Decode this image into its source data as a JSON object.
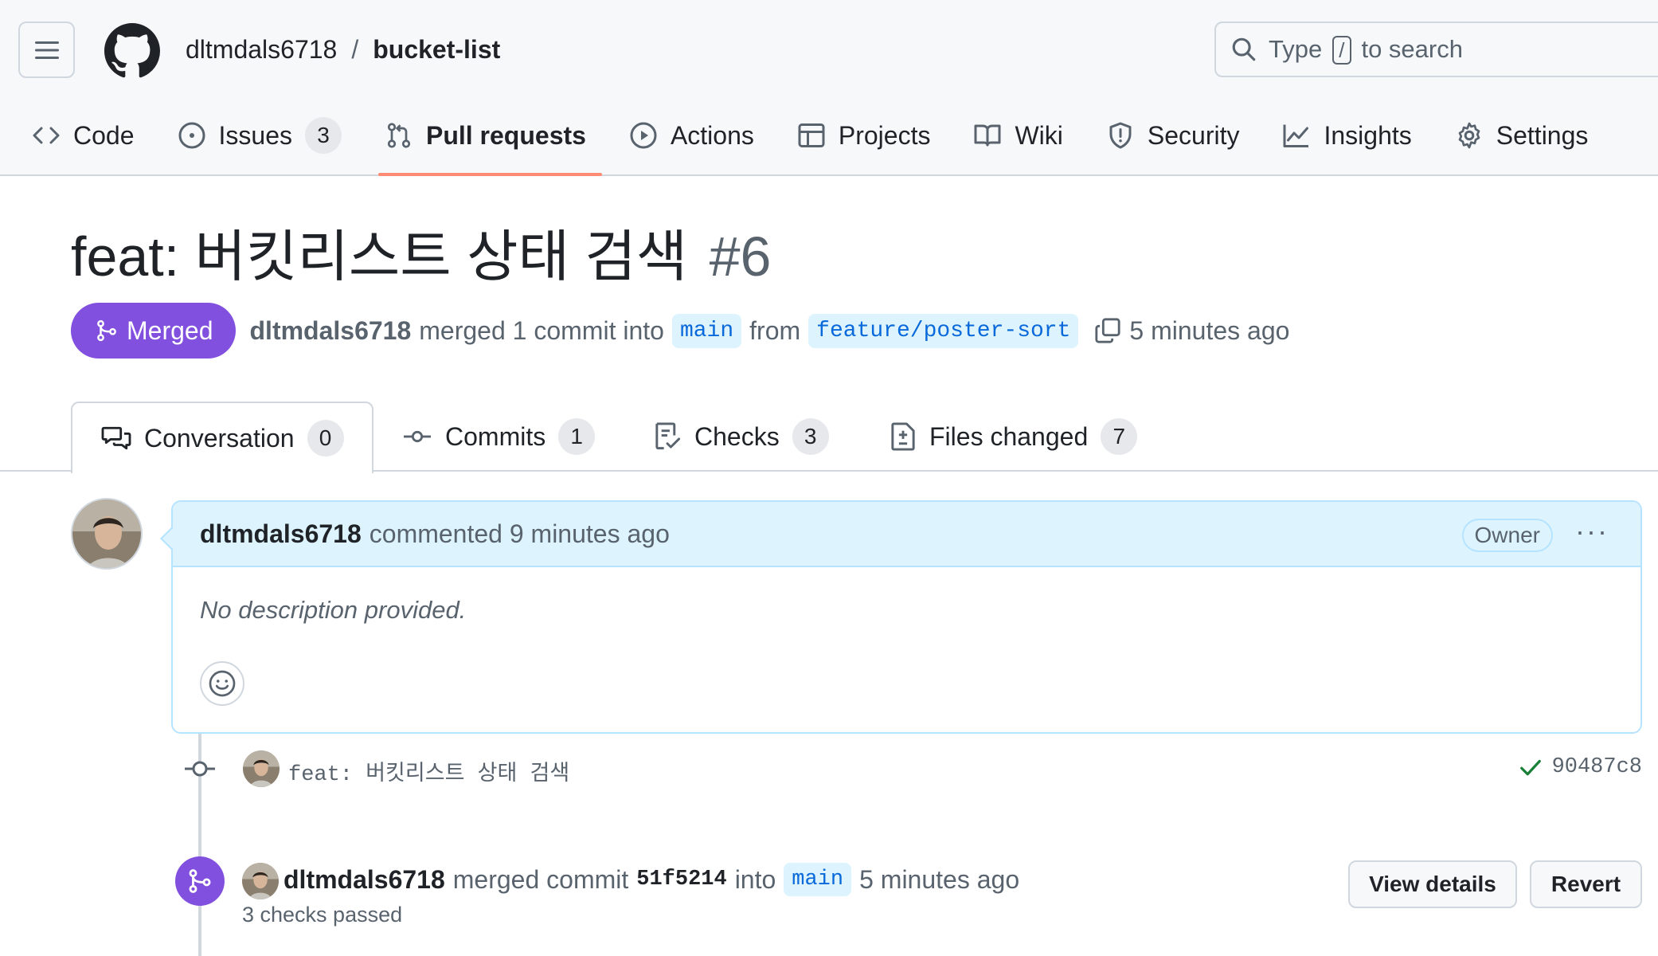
{
  "header": {
    "owner": "dltmdals6718",
    "separator": "/",
    "repo": "bucket-list",
    "search": {
      "prefix": "Type",
      "key": "/",
      "suffix": "to search"
    }
  },
  "nav": {
    "items": [
      {
        "label": "Code",
        "icon": "code-icon"
      },
      {
        "label": "Issues",
        "icon": "issue-opened-icon",
        "count": "3"
      },
      {
        "label": "Pull requests",
        "icon": "git-pull-request-icon",
        "active": true
      },
      {
        "label": "Actions",
        "icon": "play-icon"
      },
      {
        "label": "Projects",
        "icon": "table-icon"
      },
      {
        "label": "Wiki",
        "icon": "book-icon"
      },
      {
        "label": "Security",
        "icon": "shield-icon"
      },
      {
        "label": "Insights",
        "icon": "graph-icon"
      },
      {
        "label": "Settings",
        "icon": "gear-icon"
      }
    ]
  },
  "pr": {
    "title": "feat: 버킷리스트 상태 검색",
    "number": "#6",
    "state": "Merged",
    "author": "dltmdals6718",
    "action_text": "merged 1 commit into",
    "base_branch": "main",
    "from_text": "from",
    "head_branch": "feature/poster-sort",
    "time": "5 minutes ago"
  },
  "tabs": {
    "conversation": {
      "label": "Conversation",
      "count": "0"
    },
    "commits": {
      "label": "Commits",
      "count": "1"
    },
    "checks": {
      "label": "Checks",
      "count": "3"
    },
    "files": {
      "label": "Files changed",
      "count": "7"
    }
  },
  "comment": {
    "author": "dltmdals6718",
    "action": "commented 9 minutes ago",
    "role": "Owner",
    "more": "···",
    "body": "No description provided."
  },
  "commit": {
    "message": "feat: 버킷리스트 상태 검색",
    "sha": "90487c8",
    "status_color": "#1a7f37"
  },
  "merge_event": {
    "author": "dltmdals6718",
    "text1": "merged commit",
    "sha": "51f5214",
    "text2": "into",
    "branch": "main",
    "time": "5 minutes ago",
    "checks": "3 checks passed",
    "view_details": "View details",
    "revert": "Revert"
  },
  "colors": {
    "merged": "#8250df",
    "accent_underline": "#fd8c73",
    "link_bg": "#ddf4ff",
    "link": "#0969da"
  }
}
